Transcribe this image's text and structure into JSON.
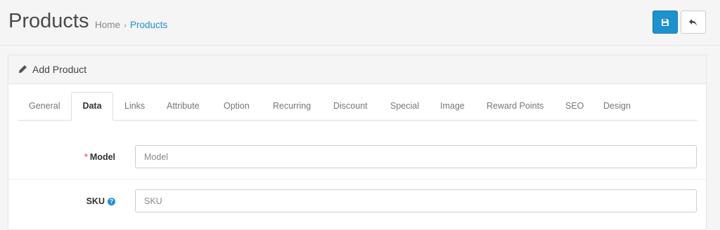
{
  "header": {
    "title": "Products",
    "breadcrumb": [
      {
        "label": "Home"
      },
      {
        "label": "Products"
      }
    ],
    "breadcrumb_separator": "›",
    "save_icon": "save-icon",
    "back_icon": "reply-icon"
  },
  "panel": {
    "title": "Add Product",
    "icon": "pencil-icon"
  },
  "tabs": [
    {
      "label": "General"
    },
    {
      "label": "Data",
      "active": true
    },
    {
      "label": "Links"
    },
    {
      "label": "Attribute"
    },
    {
      "label": "Option"
    },
    {
      "label": "Recurring"
    },
    {
      "label": "Discount"
    },
    {
      "label": "Special"
    },
    {
      "label": "Image"
    },
    {
      "label": "Reward Points"
    },
    {
      "label": "SEO"
    },
    {
      "label": "Design"
    }
  ],
  "form": {
    "model": {
      "label": "Model",
      "required_marker": "*",
      "placeholder": "Model",
      "value": ""
    },
    "sku": {
      "label": "SKU",
      "help_marker": "?",
      "placeholder": "SKU",
      "value": ""
    }
  },
  "colors": {
    "accent": "#1e91cf",
    "required": "#f56b6b"
  }
}
